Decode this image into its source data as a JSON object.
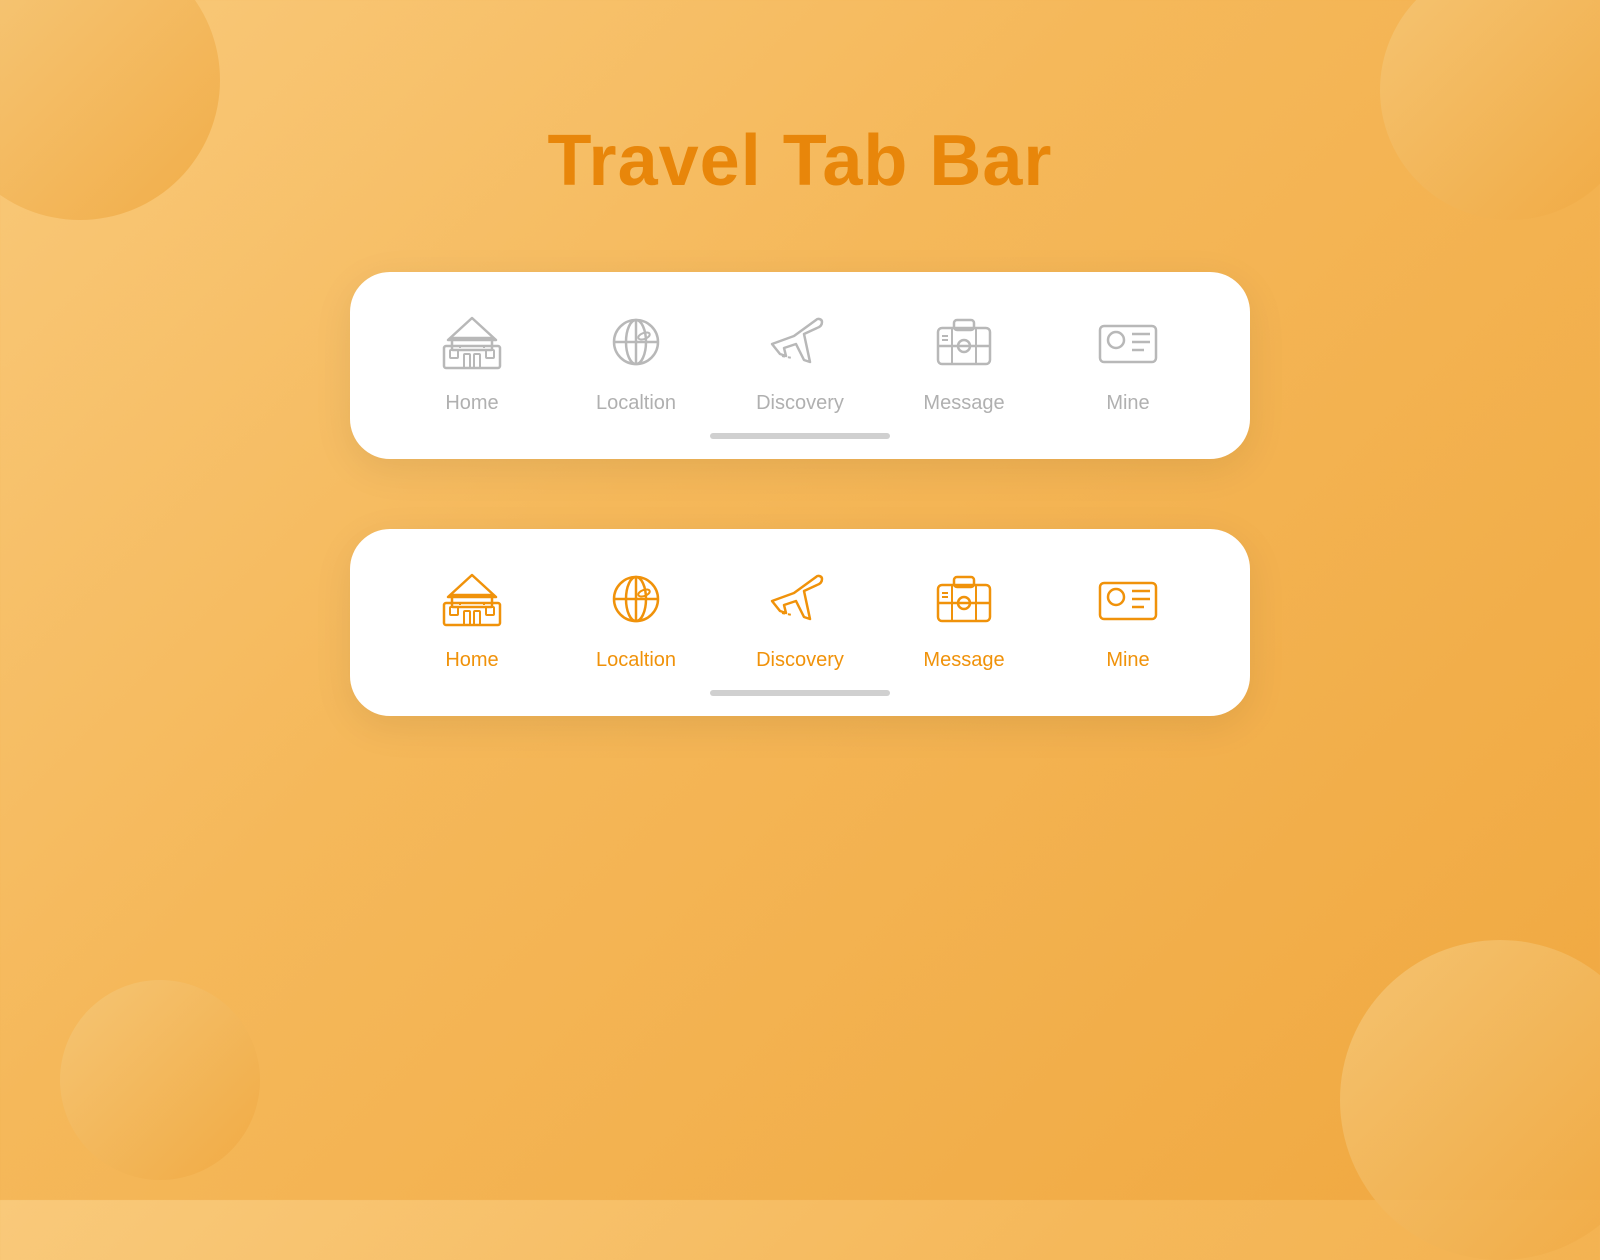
{
  "page": {
    "title": "Travel Tab Bar",
    "title_color": "#e8860a"
  },
  "tabbars": [
    {
      "id": "inactive",
      "state": "inactive",
      "items": [
        {
          "id": "home",
          "label": "Home",
          "active": false
        },
        {
          "id": "localtion",
          "label": "Localtion",
          "active": false
        },
        {
          "id": "discovery",
          "label": "Discovery",
          "active": false
        },
        {
          "id": "message",
          "label": "Message",
          "active": false
        },
        {
          "id": "mine",
          "label": "Mine",
          "active": false
        }
      ]
    },
    {
      "id": "active",
      "state": "active",
      "items": [
        {
          "id": "home",
          "label": "Home",
          "active": true
        },
        {
          "id": "localtion",
          "label": "Localtion",
          "active": true
        },
        {
          "id": "discovery",
          "label": "Discovery",
          "active": true
        },
        {
          "id": "message",
          "label": "Message",
          "active": true
        },
        {
          "id": "mine",
          "label": "Mine",
          "active": true
        }
      ]
    }
  ]
}
